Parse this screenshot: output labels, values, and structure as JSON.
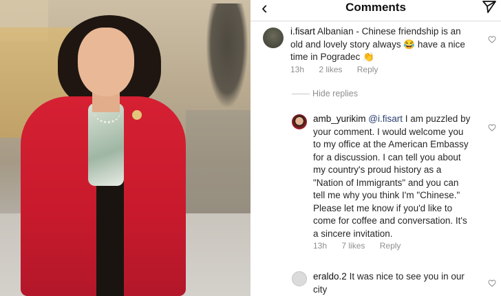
{
  "header": {
    "title": "Comments"
  },
  "comments": [
    {
      "username": "i.fisart",
      "text": "Albanian - Chinese friendship is an old and lovely story always 😂 have a nice time in Pogradec 👏",
      "time": "13h",
      "likes": "2 likes",
      "reply": "Reply"
    },
    {
      "username": "amb_yurikim",
      "mention": "@i.fisart",
      "text": "I am puzzled by your comment. I would welcome you to my office at the American Embassy for a discussion. I can tell you about my country's proud history as a \"Nation of Immigrants\" and you can tell me why you think I'm \"Chinese.\" Please let me know if you'd like to come for coffee and conversation. It's a sincere invitation.",
      "time": "13h",
      "likes": "7 likes",
      "reply": "Reply"
    },
    {
      "username": "eraldo.2",
      "text": "It was nice to see you in our city"
    }
  ],
  "hide_replies": "Hide replies",
  "colors": {
    "meta_gray": "#8e8e8e",
    "blazer_red": "#d62033"
  }
}
